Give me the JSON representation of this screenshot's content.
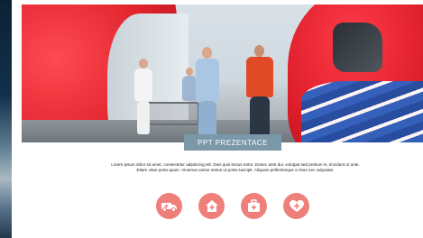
{
  "slide": {
    "badge_label": "PPT PREZENTACE",
    "description": "Lorem ipsum dolor sit amet, consectetur adipiscing elit. Duis quis lectus tortor. Donec ante dui, volutpat sed pretium in, tincidunt ut ante. Etiam vitae porta quam. Vivamus varius metus ut porta suscipit. Aliquam pellentesque a risus nec vulputate.",
    "accent_color": "#ef7f7a",
    "badge_color": "#7a98a8",
    "icons": [
      {
        "name": "ambulance-icon"
      },
      {
        "name": "hospital-house-icon"
      },
      {
        "name": "first-aid-kit-icon"
      },
      {
        "name": "heart-plus-icon"
      }
    ]
  }
}
